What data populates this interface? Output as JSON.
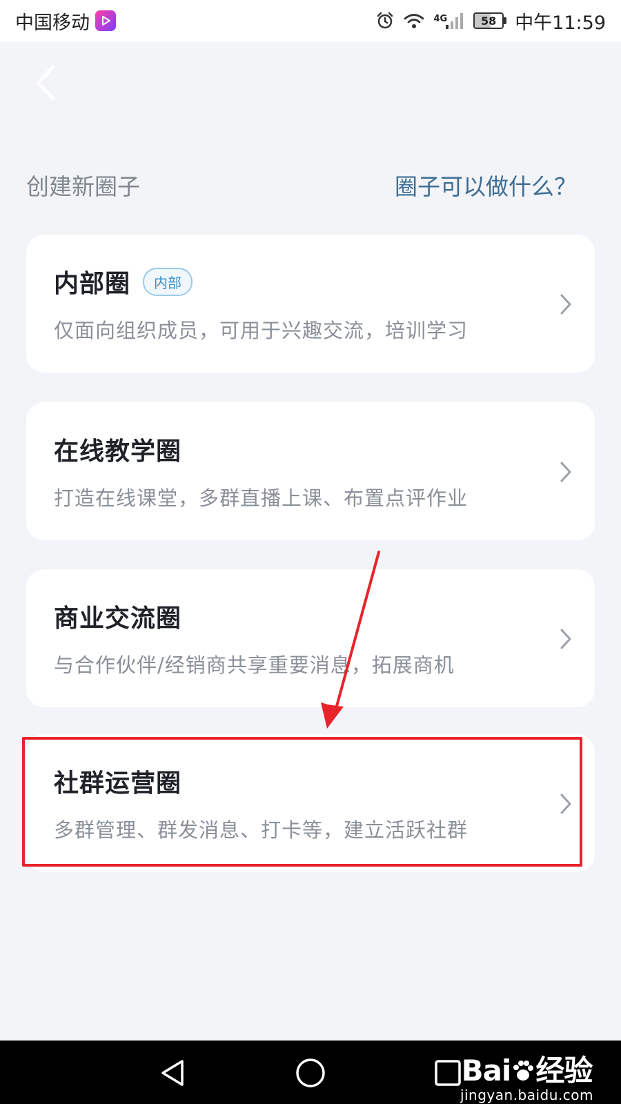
{
  "status_bar": {
    "carrier": "中国移动",
    "network": "4G",
    "battery": "58",
    "battery_level": 0.58,
    "time": "中午11:59"
  },
  "header": {
    "section_title": "创建新圈子",
    "help_link": "圈子可以做什么？"
  },
  "cards": [
    {
      "title": "内部圈",
      "badge": "内部",
      "desc": "仅面向组织成员，可用于兴趣交流，培训学习"
    },
    {
      "title": "在线教学圈",
      "desc": "打造在线课堂，多群直播上课、布置点评作业"
    },
    {
      "title": "商业交流圈",
      "desc": "与合作伙伴/经销商共享重要消息，拓展商机"
    },
    {
      "title": "社群运营圈",
      "desc": "多群管理、群发消息、打卡等，建立活跃社群"
    }
  ],
  "watermark": {
    "logo_text_left": "Bai",
    "logo_text_right": "经验",
    "sub": "jingyan.baidu.com"
  },
  "colors": {
    "background": "#f2f4f7",
    "link": "#3f6e95",
    "highlight": "#e8242b",
    "badge": "#3a8dc7"
  }
}
